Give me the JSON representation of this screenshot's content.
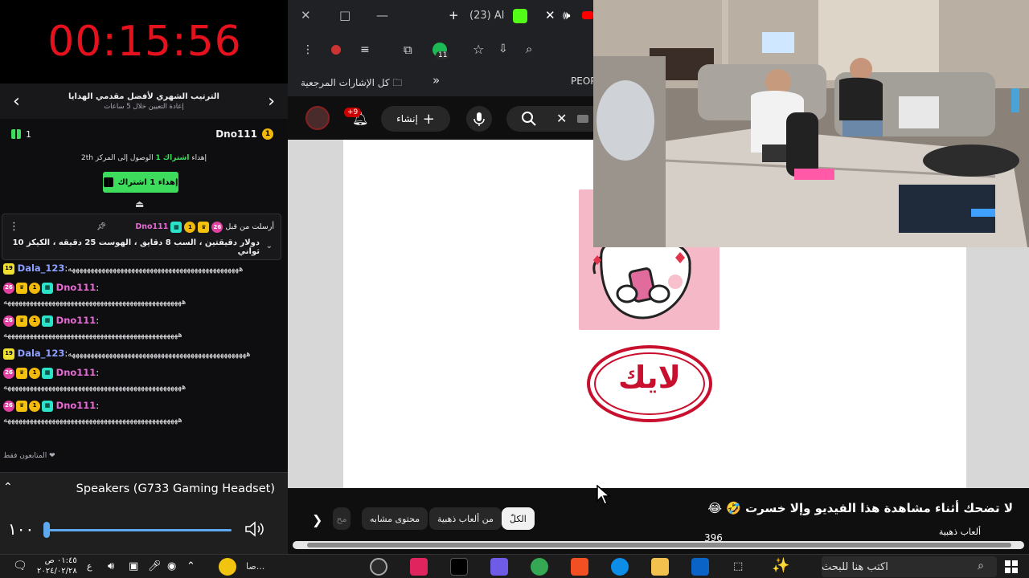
{
  "timer": "00:15:56",
  "gift_panel": {
    "title": "الترتيب الشهري لأفضل مقدمي الهدايا",
    "subtitle": "إعادة التعيين خلال 5 ساعات",
    "top_user": "Dno111",
    "top_rank": "1",
    "gift_count": "1",
    "progress_text_prefix": "th",
    "progress_text_mid": "الوصول إلى المركز 2",
    "progress_text_highlight": "اشتراك 1",
    "progress_text_suffix": "إهداء",
    "gift_button": "إهداء 1 اشتراك"
  },
  "pinned": {
    "header": "أرسلت من قبل",
    "user": "Dno111",
    "message": "دولار دقيقتين ، السب 8 دقايق ، الهوست 25 دقيقه ، الكيكز 10 ثواني",
    "badge_level": "26"
  },
  "chat": [
    {
      "badge": "19",
      "user": "Dala_123",
      "text": "ههههههههههههههههههههههههههههههههههههههههههههههه",
      "color": "blue",
      "inline": true
    },
    {
      "badge": "26",
      "user": "Dno111",
      "text": "ههههههههههههههههههههههههههههههههههههههههههههههههه",
      "color": "pink",
      "inline": false
    },
    {
      "badge": "26",
      "user": "Dno111",
      "text": "هههههههههههههههههههههههههههههههههههههههههههههههه",
      "color": "pink",
      "inline": false
    },
    {
      "badge": "19",
      "user": "Dala_123",
      "text": "ههههههههههههههههههههههههههههههههههههههههههههههههه",
      "color": "blue",
      "inline": true
    },
    {
      "badge": "26",
      "user": "Dno111",
      "text": "ههههههههههههههههههههههههههههههههههههههههههههههههه",
      "color": "pink",
      "inline": false
    },
    {
      "badge": "26",
      "user": "Dno111",
      "text": "هههههههههههههههههههههههههههههههههههههههههههههههه",
      "color": "pink",
      "inline": false
    }
  ],
  "followers_only": "المتابعون فقط",
  "volume": {
    "device": "Speakers (G733 Gaming Headset)",
    "level_text": "١٠٠",
    "level": 100
  },
  "browser": {
    "tab_title": "(23) Al",
    "bookmarks_label": "كل الإشارات المرجعية",
    "bookmark_people": "PEOP",
    "extension_badge": "11"
  },
  "youtube": {
    "create_label": "إنشاء",
    "notification_badge": "+9",
    "video_title": "لا تضحك أثناء مشاهدة هذا الفيديو وإلا خسرت 🤣 😂",
    "channel_name": "ألعاب ذهبية",
    "like_count": "396",
    "chips": [
      "الكلّ",
      "من ألعاب ذهبية",
      "محتوى مشابه",
      "مح"
    ],
    "sticker_text": "لايك"
  },
  "taskbar": {
    "time": "٠١:٤٥ ص",
    "date": "٢٠٢٤/٠٢/٢٨",
    "lang": "ع",
    "search_placeholder": "اكتب هنا للبحث",
    "truncated_app": "صا..."
  },
  "colors": {
    "timer_red": "#e5121e",
    "kick_green": "#3ddc5c",
    "volume_blue": "#5ea8f0",
    "youtube_red": "#ff0000"
  }
}
